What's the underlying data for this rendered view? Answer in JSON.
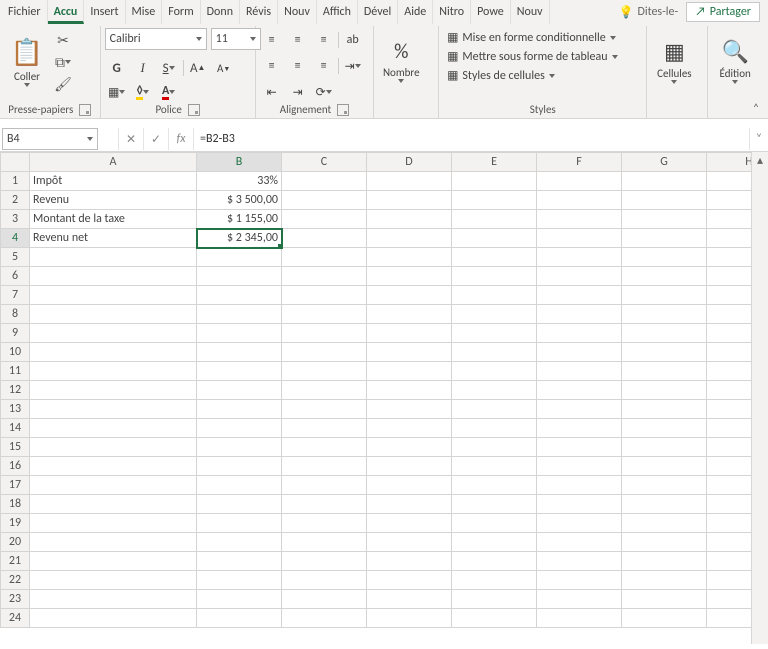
{
  "tabs": {
    "file": "Fichier",
    "home": "Accu",
    "insert": "Insert",
    "layout": "Mise",
    "formulas": "Form",
    "data": "Donn",
    "review": "Révis",
    "new1": "Nouv",
    "view": "Affich",
    "dev": "Dével",
    "help": "Aide",
    "nitro": "Nitro",
    "power": "Powe",
    "new2": "Nouv"
  },
  "tell_me": "Dites-le-",
  "share": "Partager",
  "groups": {
    "clipboard": {
      "paste": "Coller",
      "label": "Presse-papiers"
    },
    "font": {
      "name": "Calibri",
      "size": "11",
      "label": "Police"
    },
    "alignment": {
      "label": "Alignement"
    },
    "number": {
      "name": "Nombre",
      "pct": "%"
    },
    "styles": {
      "conditional": "Mise en forme conditionnelle",
      "table": "Mettre sous forme de tableau",
      "cell": "Styles de cellules",
      "label": "Styles"
    },
    "cells": "Cellules",
    "editing": "Édition"
  },
  "cellref": "B4",
  "formula": "=B2-B3",
  "columns": [
    "A",
    "B",
    "C",
    "D",
    "E",
    "F",
    "G",
    "H"
  ],
  "rows_count": 24,
  "data": {
    "A1": "Impôt",
    "B1": "33%",
    "A2": "Revenu",
    "B2": "$   3 500,00",
    "A3": "Montant de la taxe",
    "B3": "$   1 155,00",
    "A4": "Revenu net",
    "B4": "$   2 345,00"
  },
  "selected": {
    "row": 4,
    "col": "B"
  }
}
